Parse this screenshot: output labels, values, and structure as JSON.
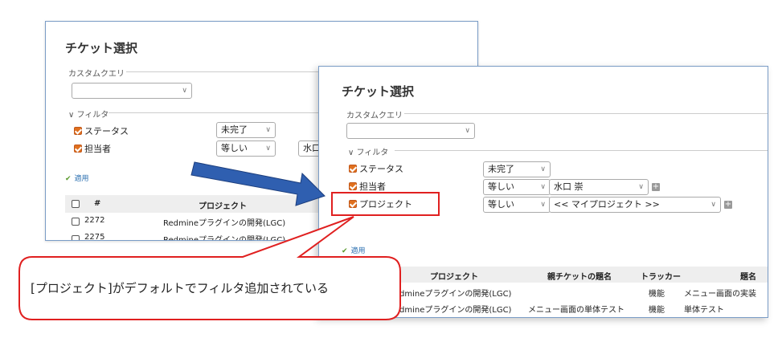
{
  "back": {
    "title": "チケット選択",
    "custom_query_label": "カスタムクエリ",
    "filter_label": "∨ フィルタ",
    "filters": [
      {
        "label": "ステータス",
        "operator": "未完了"
      },
      {
        "label": "担当者",
        "operator": "等しい",
        "value": "水口"
      }
    ],
    "apply_label": "適用",
    "table": {
      "headers": [
        "#",
        "プロジェクト"
      ],
      "rows": [
        {
          "id": "2272",
          "project": "Redmineプラグインの開発(LGC)"
        },
        {
          "id": "2275",
          "project": "Redmineプラグインの開発(LGC)"
        }
      ]
    }
  },
  "front": {
    "title": "チケット選択",
    "custom_query_label": "カスタムクエリ",
    "filter_label": "∨ フィルタ",
    "filters": [
      {
        "label": "ステータス",
        "operator": "未完了"
      },
      {
        "label": "担当者",
        "operator": "等しい",
        "value": "水口 崇"
      },
      {
        "label": "プロジェクト",
        "operator": "等しい",
        "value": "<< マイプロジェクト >>"
      }
    ],
    "apply_label": "適用",
    "table": {
      "headers": [
        "プロジェクト",
        "親チケットの題名",
        "トラッカー",
        "題名"
      ],
      "rows": [
        {
          "project": "dmineプラグインの開発(LGC)",
          "parent": "",
          "tracker": "機能",
          "subject": "メニュー画面の実装"
        },
        {
          "project": "dmineプラグインの開発(LGC)",
          "parent": "メニュー画面の単体テスト",
          "tracker": "機能",
          "subject": "単体テスト"
        }
      ]
    }
  },
  "callout": {
    "text": "[プロジェクト]がデフォルトでフィルタ追加されている"
  },
  "colors": {
    "checkbox": "#e0701e",
    "highlight": "#e02020",
    "arrow": "#2f5fb0",
    "panel_border": "#7a9cc6"
  }
}
